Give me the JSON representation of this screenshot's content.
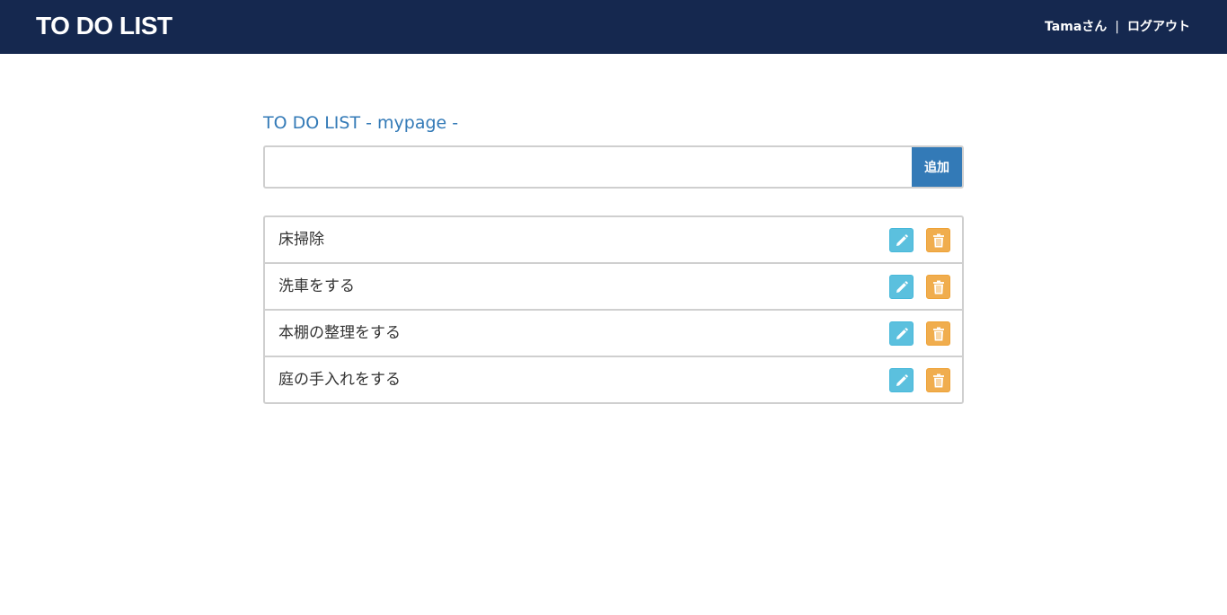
{
  "header": {
    "brand": "TO DO LIST",
    "user_label": "Tamaさん",
    "separator": "|",
    "logout_label": "ログアウト",
    "background": "#15284f"
  },
  "main": {
    "title": "TO DO LIST - mypage -",
    "title_color": "#337ab7",
    "add_form": {
      "input_value": "",
      "input_placeholder": "",
      "add_label": "追加",
      "button_color": "#337ab7"
    },
    "todos": [
      {
        "text": "床掃除",
        "edit_icon": "pencil-icon",
        "delete_icon": "trash-icon"
      },
      {
        "text": "洗車をする",
        "edit_icon": "pencil-icon",
        "delete_icon": "trash-icon"
      },
      {
        "text": "本棚の整理をする",
        "edit_icon": "pencil-icon",
        "delete_icon": "trash-icon"
      },
      {
        "text": "庭の手入れをする",
        "edit_icon": "pencil-icon",
        "delete_icon": "trash-icon"
      }
    ],
    "edit_button_color": "#5bc0de",
    "delete_button_color": "#f0ad4e"
  }
}
